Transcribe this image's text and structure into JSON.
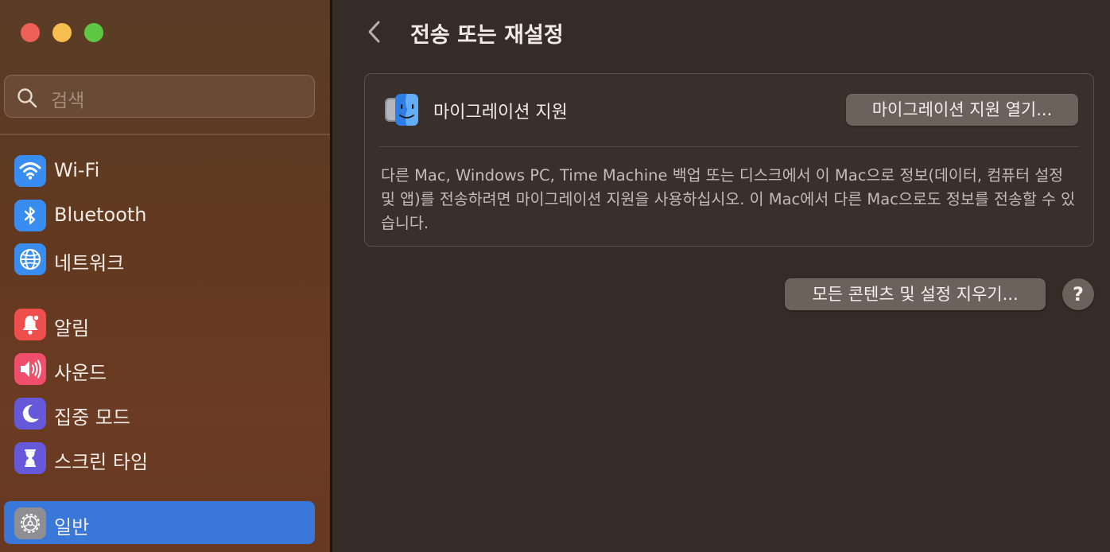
{
  "window": {
    "title": "전송 또는 재설정"
  },
  "colors": {
    "accent": "#3977d9",
    "close": "#ee5f57",
    "minimize": "#f5be4f",
    "zoom": "#5ec845"
  },
  "sidebar": {
    "search_placeholder": "검색",
    "items": [
      {
        "label": "Wi-Fi",
        "icon": "wifi-icon",
        "active": false
      },
      {
        "label": "Bluetooth",
        "icon": "bluetooth-icon",
        "active": false
      },
      {
        "label": "네트워크",
        "icon": "network-globe-icon",
        "active": false
      },
      {
        "label": "알림",
        "icon": "bell-icon",
        "active": false
      },
      {
        "label": "사운드",
        "icon": "speaker-icon",
        "active": false
      },
      {
        "label": "집중 모드",
        "icon": "moon-icon",
        "active": false
      },
      {
        "label": "스크린 타임",
        "icon": "hourglass-icon",
        "active": false
      },
      {
        "label": "일반",
        "icon": "gear-icon",
        "active": true
      }
    ]
  },
  "main": {
    "migration": {
      "label": "마이그레이션 지원",
      "button": "마이그레이션 지원 열기...",
      "description": "다른 Mac, Windows PC, Time Machine 백업 또는 디스크에서 이 Mac으로 정보(데이터, 컴퓨터 설정 및 앱)를 전송하려면 마이그레이션 지원을 사용하십시오. 이 Mac에서 다른 Mac으로도 정보를 전송할 수 있습니다."
    },
    "erase_button": "모든 콘텐츠 및 설정 지우기...",
    "help_label": "?"
  }
}
